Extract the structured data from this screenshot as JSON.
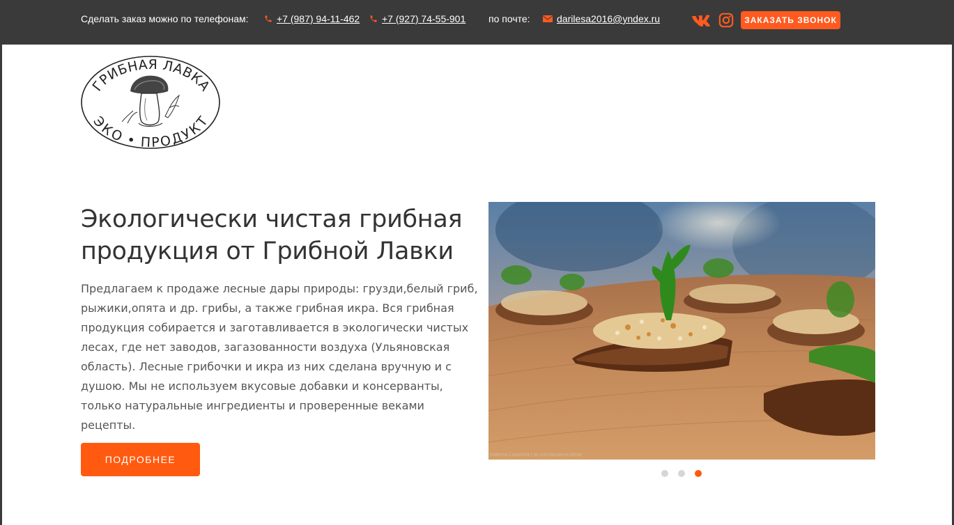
{
  "topbar": {
    "phones_label": "Сделать заказ можно по телефонам:",
    "phone1": "+7 (987) 94-11-462",
    "phone2": "+7 (927) 74-55-901",
    "email_label": "по почте:",
    "email": "darilesa2016@yndex.ru",
    "social_icons": [
      "vk-icon",
      "instagram-icon"
    ],
    "callback_button": "ЗАКАЗАТЬ ЗВОНОК"
  },
  "logo": {
    "top_text": "ГРИБНАЯ ЛАВКА",
    "bottom_text": "ЭКО • ПРОДУКТ"
  },
  "hero": {
    "title_line1": "Экологически чистая грибная",
    "title_line2": "продукция от Грибной Лавки",
    "text_lines": [
      "Предлагаем к продаже лесные дары природы: грузди,белый гриб,",
      "рыжики,опята и др. грибы, а также грибная икра. Вся грибная",
      "продукция собирается и заготавливается в экологически чистых",
      "лесах, где нет заводов, загазованности воздуха (Ульяновская",
      "область). Лесные грибочки и икра из них сделана вручную и с",
      "душою. Мы не используем вкусовые добавки и консерванты,",
      "только натуральные ингредиенты и проверенные веками рецепты."
    ],
    "more_button": "ПОДРОБНЕЕ"
  },
  "slider": {
    "image_alt": "Грибная икра на хлебцах с петрушкой",
    "credit": "Katerina Lazareva | vk.com/lazareva.photo",
    "slide_count": 3,
    "active_slide": 3
  },
  "colors": {
    "topbar_bg": "#3a3a3a",
    "accent": "#ff5a0f"
  }
}
